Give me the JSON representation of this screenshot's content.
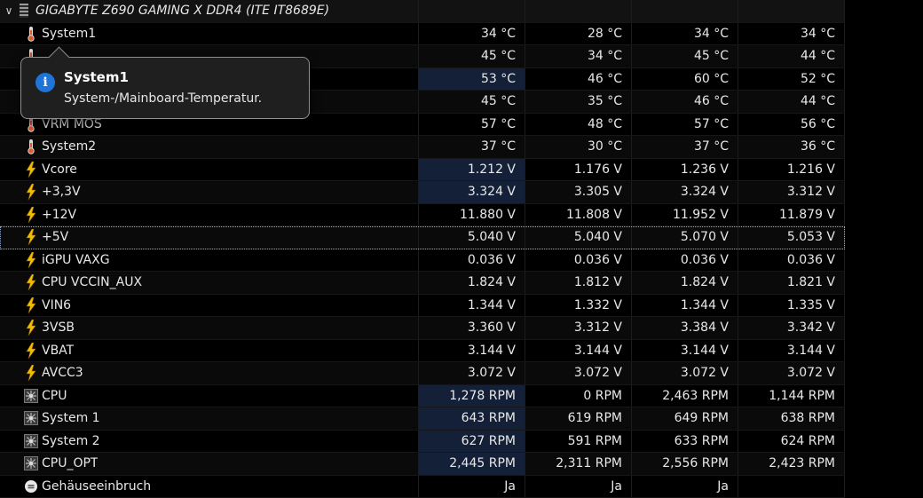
{
  "device": {
    "title": "GIGABYTE Z690 GAMING X DDR4 (ITE IT8689E)"
  },
  "colors": {
    "highlight_cell": "#142038",
    "tooltip_icon": "#1e74d8",
    "voltage_icon": "#f0c000"
  },
  "rows": [
    {
      "icon": "thermometer-icon",
      "name": "System1",
      "values": [
        "34 °C",
        "28 °C",
        "34 °C",
        "34 °C"
      ]
    },
    {
      "icon": "thermometer-icon",
      "name": "",
      "values": [
        "45 °C",
        "34 °C",
        "45 °C",
        "44 °C"
      ]
    },
    {
      "icon": "thermometer-icon",
      "name": "",
      "values": [
        "53 °C",
        "46 °C",
        "60 °C",
        "52 °C"
      ]
    },
    {
      "icon": "thermometer-icon",
      "name": "",
      "values": [
        "45 °C",
        "35 °C",
        "46 °C",
        "44 °C"
      ]
    },
    {
      "icon": "thermometer-icon",
      "name": "VRM MOS",
      "values": [
        "57 °C",
        "48 °C",
        "57 °C",
        "56 °C"
      ]
    },
    {
      "icon": "thermometer-icon",
      "name": "System2",
      "values": [
        "37 °C",
        "30 °C",
        "37 °C",
        "36 °C"
      ]
    },
    {
      "icon": "lightning-icon",
      "name": "Vcore",
      "values": [
        "1.212 V",
        "1.176 V",
        "1.236 V",
        "1.216 V"
      ]
    },
    {
      "icon": "lightning-icon",
      "name": "+3,3V",
      "values": [
        "3.324 V",
        "3.305 V",
        "3.324 V",
        "3.312 V"
      ]
    },
    {
      "icon": "lightning-icon",
      "name": "+12V",
      "values": [
        "11.880 V",
        "11.808 V",
        "11.952 V",
        "11.879 V"
      ]
    },
    {
      "icon": "lightning-icon",
      "name": "+5V",
      "values": [
        "5.040 V",
        "5.040 V",
        "5.070 V",
        "5.053 V"
      ]
    },
    {
      "icon": "lightning-icon",
      "name": "iGPU VAXG",
      "values": [
        "0.036 V",
        "0.036 V",
        "0.036 V",
        "0.036 V"
      ]
    },
    {
      "icon": "lightning-icon",
      "name": "CPU VCCIN_AUX",
      "values": [
        "1.824 V",
        "1.812 V",
        "1.824 V",
        "1.821 V"
      ]
    },
    {
      "icon": "lightning-icon",
      "name": "VIN6",
      "values": [
        "1.344 V",
        "1.332 V",
        "1.344 V",
        "1.335 V"
      ]
    },
    {
      "icon": "lightning-icon",
      "name": "3VSB",
      "values": [
        "3.360 V",
        "3.312 V",
        "3.384 V",
        "3.342 V"
      ]
    },
    {
      "icon": "lightning-icon",
      "name": "VBAT",
      "values": [
        "3.144 V",
        "3.144 V",
        "3.144 V",
        "3.144 V"
      ]
    },
    {
      "icon": "lightning-icon",
      "name": "AVCC3",
      "values": [
        "3.072 V",
        "3.072 V",
        "3.072 V",
        "3.072 V"
      ]
    },
    {
      "icon": "fan-icon",
      "name": "CPU",
      "values": [
        "1,278 RPM",
        "0 RPM",
        "2,463 RPM",
        "1,144 RPM"
      ]
    },
    {
      "icon": "fan-icon",
      "name": "System 1",
      "values": [
        "643 RPM",
        "619 RPM",
        "649 RPM",
        "638 RPM"
      ]
    },
    {
      "icon": "fan-icon",
      "name": "System 2",
      "values": [
        "627 RPM",
        "591 RPM",
        "633 RPM",
        "624 RPM"
      ]
    },
    {
      "icon": "fan-icon",
      "name": "CPU_OPT",
      "values": [
        "2,445 RPM",
        "2,311 RPM",
        "2,556 RPM",
        "2,423 RPM"
      ]
    },
    {
      "icon": "chassis-intrusion-icon",
      "name": "Gehäuseeinbruch",
      "values": [
        "Ja",
        "Ja",
        "Ja",
        ""
      ]
    }
  ],
  "tooltip": {
    "title": "System1",
    "text": "System-/Mainboard-Temperatur."
  }
}
